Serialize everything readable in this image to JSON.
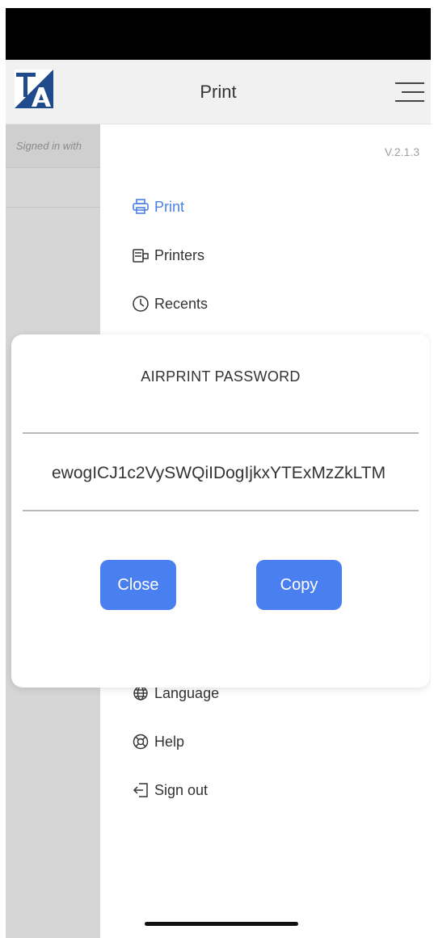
{
  "header": {
    "title": "Print",
    "logo_text": "TA",
    "menu_icon": "hamburger-icon"
  },
  "sidebar": {
    "signed_in_text": "Signed in with"
  },
  "version": "V.2.1.3",
  "menu": {
    "items": [
      {
        "label": "Print",
        "icon": "printer-icon",
        "active": true
      },
      {
        "label": "Printers",
        "icon": "printers-icon",
        "active": false
      },
      {
        "label": "Recents",
        "icon": "clock-icon",
        "active": false
      },
      {
        "label": "Language",
        "icon": "globe-icon",
        "active": false
      },
      {
        "label": "Help",
        "icon": "lifebuoy-icon",
        "active": false
      },
      {
        "label": "Sign out",
        "icon": "sign-out-icon",
        "active": false
      }
    ]
  },
  "dialog": {
    "title": "AIRPRINT PASSWORD",
    "password": "ewogICJ1c2VySWQiIDogIjkxYTExMzZkLTM",
    "close_label": "Close",
    "copy_label": "Copy"
  },
  "colors": {
    "accent": "#4a7fef",
    "active_menu": "#4a7fe6",
    "sidebar": "#d6d6d6",
    "header": "#f1f1f1"
  }
}
